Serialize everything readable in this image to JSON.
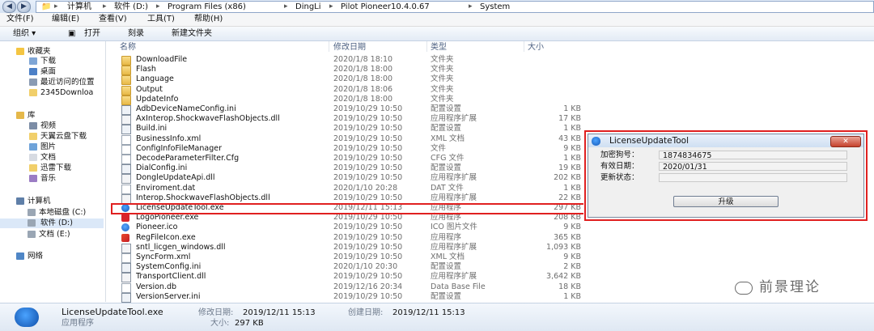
{
  "address_bar": {
    "crumbs": [
      "计算机",
      "软件 (D:)",
      "Program Files (x86)",
      "DingLi",
      "Pilot Pioneer10.4.0.67",
      "System"
    ]
  },
  "menu": {
    "items": [
      "文件(F)",
      "编辑(E)",
      "查看(V)",
      "工具(T)",
      "帮助(H)"
    ]
  },
  "toolbar": {
    "organize": "组织 ▾",
    "open": "打开",
    "burn": "刻录",
    "new_folder": "新建文件夹"
  },
  "nav": {
    "favorites": "收藏夹",
    "downloads": "下载",
    "desktop": "桌面",
    "recent": "最近访问的位置",
    "download2345": "2345Downloa",
    "libraries": "库",
    "video": "视频",
    "tianyi": "天翼云盘下载",
    "pictures": "图片",
    "documents": "文档",
    "xunlei": "迅雷下载",
    "music": "音乐",
    "computer": "计算机",
    "local_c": "本地磁盘 (C:)",
    "soft_d": "软件 (D:)",
    "doc_e": "文档 (E:)",
    "network": "网络"
  },
  "columns": {
    "name": "名称",
    "date": "修改日期",
    "type": "类型",
    "size": "大小"
  },
  "files": [
    {
      "name": "DownloadFile",
      "date": "2020/1/8 18:10",
      "type": "文件夹",
      "size": "",
      "icon": "folder-icon"
    },
    {
      "name": "Flash",
      "date": "2020/1/8 18:00",
      "type": "文件夹",
      "size": "",
      "icon": "folder-icon"
    },
    {
      "name": "Language",
      "date": "2020/1/8 18:00",
      "type": "文件夹",
      "size": "",
      "icon": "folder-icon"
    },
    {
      "name": "Output",
      "date": "2020/1/8 18:06",
      "type": "文件夹",
      "size": "",
      "icon": "folder-icon"
    },
    {
      "name": "UpdateInfo",
      "date": "2020/1/8 18:00",
      "type": "文件夹",
      "size": "",
      "icon": "folder-icon"
    },
    {
      "name": "AdbDeviceNameConfig.ini",
      "date": "2019/10/29 10:50",
      "type": "配置设置",
      "size": "1 KB",
      "icon": "config-file-icon"
    },
    {
      "name": "AxInterop.ShockwaveFlashObjects.dll",
      "date": "2019/10/29 10:50",
      "type": "应用程序扩展",
      "size": "17 KB",
      "icon": "dll-file-icon"
    },
    {
      "name": "Build.ini",
      "date": "2019/10/29 10:50",
      "type": "配置设置",
      "size": "1 KB",
      "icon": "config-file-icon"
    },
    {
      "name": "BusinessInfo.xml",
      "date": "2019/10/29 10:50",
      "type": "XML 文档",
      "size": "43 KB",
      "icon": "xml-file-icon"
    },
    {
      "name": "ConfigInfoFileManager",
      "date": "2019/10/29 10:50",
      "type": "文件",
      "size": "9 KB",
      "icon": "file-icon"
    },
    {
      "name": "DecodeParameterFilter.Cfg",
      "date": "2019/10/29 10:50",
      "type": "CFG 文件",
      "size": "1 KB",
      "icon": "file-icon"
    },
    {
      "name": "DialConfig.ini",
      "date": "2019/10/29 10:50",
      "type": "配置设置",
      "size": "19 KB",
      "icon": "config-file-icon"
    },
    {
      "name": "DongleUpdateApi.dll",
      "date": "2019/10/29 10:50",
      "type": "应用程序扩展",
      "size": "202 KB",
      "icon": "dll-file-icon"
    },
    {
      "name": "Enviroment.dat",
      "date": "2020/1/10 20:28",
      "type": "DAT 文件",
      "size": "1 KB",
      "icon": "file-icon"
    },
    {
      "name": "Interop.ShockwaveFlashObjects.dll",
      "date": "2019/10/29 10:50",
      "type": "应用程序扩展",
      "size": "22 KB",
      "icon": "dll-file-icon"
    },
    {
      "name": "LicenseUpdateTool.exe",
      "date": "2019/12/11 15:13",
      "type": "应用程序",
      "size": "297 KB",
      "icon": "license-app-icon"
    },
    {
      "name": "LogoPioneer.exe",
      "date": "2019/10/29 10:50",
      "type": "应用程序",
      "size": "208 KB",
      "icon": "pioneer-app-icon"
    },
    {
      "name": "Pioneer.ico",
      "date": "2019/10/29 10:50",
      "type": "ICO 图片文件",
      "size": "9 KB",
      "icon": "ico-file-icon"
    },
    {
      "name": "RegFileIcon.exe",
      "date": "2019/10/29 10:50",
      "type": "应用程序",
      "size": "365 KB",
      "icon": "red-app-icon"
    },
    {
      "name": "sntl_licgen_windows.dll",
      "date": "2019/10/29 10:50",
      "type": "应用程序扩展",
      "size": "1,093 KB",
      "icon": "dll-file-icon"
    },
    {
      "name": "SyncForm.xml",
      "date": "2019/10/29 10:50",
      "type": "XML 文档",
      "size": "9 KB",
      "icon": "xml-file-icon"
    },
    {
      "name": "SystemConfig.ini",
      "date": "2020/1/10 20:30",
      "type": "配置设置",
      "size": "2 KB",
      "icon": "config-file-icon"
    },
    {
      "name": "TransportClient.dll",
      "date": "2019/10/29 10:50",
      "type": "应用程序扩展",
      "size": "3,642 KB",
      "icon": "dll-file-icon"
    },
    {
      "name": "Version.db",
      "date": "2019/12/16 20:34",
      "type": "Data Base File",
      "size": "18 KB",
      "icon": "file-icon"
    },
    {
      "name": "VersionServer.ini",
      "date": "2019/10/29 10:50",
      "type": "配置设置",
      "size": "1 KB",
      "icon": "config-file-icon"
    }
  ],
  "dialog": {
    "title": "LicenseUpdateTool",
    "close": "✕",
    "encrypt_label": "加密狗号：",
    "encrypt_value": "1874834675",
    "expiry_label": "有效日期：",
    "expiry_value": "2020/01/31",
    "status_label": "更新状态：",
    "status_value": "",
    "upgrade_button": "升级"
  },
  "status": {
    "filename": "LicenseUpdateTool.exe",
    "filetype": "应用程序",
    "modified_label": "修改日期:",
    "modified_value": "2019/12/11 15:13",
    "created_label": "创建日期:",
    "created_value": "2019/12/11 15:13",
    "size_label": "大小:",
    "size_value": "297 KB"
  },
  "watermark": {
    "text": "前景理论"
  },
  "colors": {
    "highlight_border": "#e02020",
    "selection_bg": "#dbe8f8"
  }
}
